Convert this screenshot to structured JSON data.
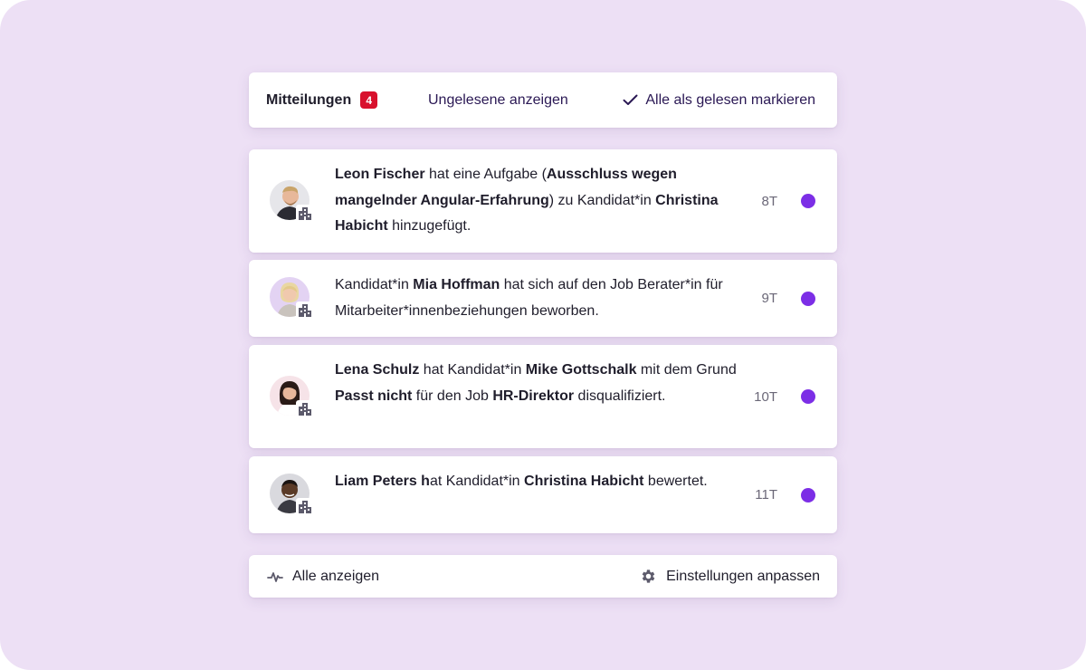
{
  "header": {
    "title": "Mitteilungen",
    "badge_count": "4",
    "show_unread_label": "Ungelesene anzeigen",
    "mark_all_read_label": "Alle als gelesen markieren"
  },
  "notifications": [
    {
      "segments": [
        {
          "t": "Leon Fischer",
          "b": true
        },
        {
          "t": " hat eine Aufgabe (",
          "b": false
        },
        {
          "t": "Ausschluss wegen mangelnder Angular-Erfahrung",
          "b": true
        },
        {
          "t": ") zu Kandidat*in ",
          "b": false
        },
        {
          "t": "Christina Habicht",
          "b": true
        },
        {
          "t": " hinzugefügt.",
          "b": false
        }
      ],
      "time": "8T",
      "avatar_icon": "person-avatar-man-blond",
      "unread": true
    },
    {
      "segments": [
        {
          "t": "Kandidat*in ",
          "b": false
        },
        {
          "t": "Mia Hoffman",
          "b": true
        },
        {
          "t": " hat sich auf den Job Berater*in für Mitarbeiter*innenbeziehungen beworben.",
          "b": false
        }
      ],
      "time": "9T",
      "avatar_icon": "person-avatar-woman-blonde",
      "unread": true
    },
    {
      "segments": [
        {
          "t": "Lena Schulz",
          "b": true
        },
        {
          "t": " hat Kandidat*in ",
          "b": false
        },
        {
          "t": "Mike Gottschalk",
          "b": true
        },
        {
          "t": " mit dem Grund ",
          "b": false
        },
        {
          "t": "Passt nicht",
          "b": true
        },
        {
          "t": " für den Job ",
          "b": false
        },
        {
          "t": "HR-Direktor",
          "b": true
        },
        {
          "t": " disqualifiziert.",
          "b": false
        }
      ],
      "time": "10T",
      "avatar_icon": "person-avatar-woman-dark-hair",
      "unread": true
    },
    {
      "segments": [
        {
          "t": "Liam Peters h",
          "b": true
        },
        {
          "t": "at Kandidat*in ",
          "b": false
        },
        {
          "t": "Christina Habicht",
          "b": true
        },
        {
          "t": " bewertet.",
          "b": false
        }
      ],
      "time": "11T",
      "avatar_icon": "person-avatar-man-dark",
      "unread": true
    }
  ],
  "footer": {
    "show_all_label": "Alle anzeigen",
    "settings_label": "Einstellungen anpassen"
  },
  "colors": {
    "background": "#ede0f5",
    "badge": "#d8112d",
    "unread_dot": "#7c2ee6",
    "link_text": "#2a1854"
  }
}
